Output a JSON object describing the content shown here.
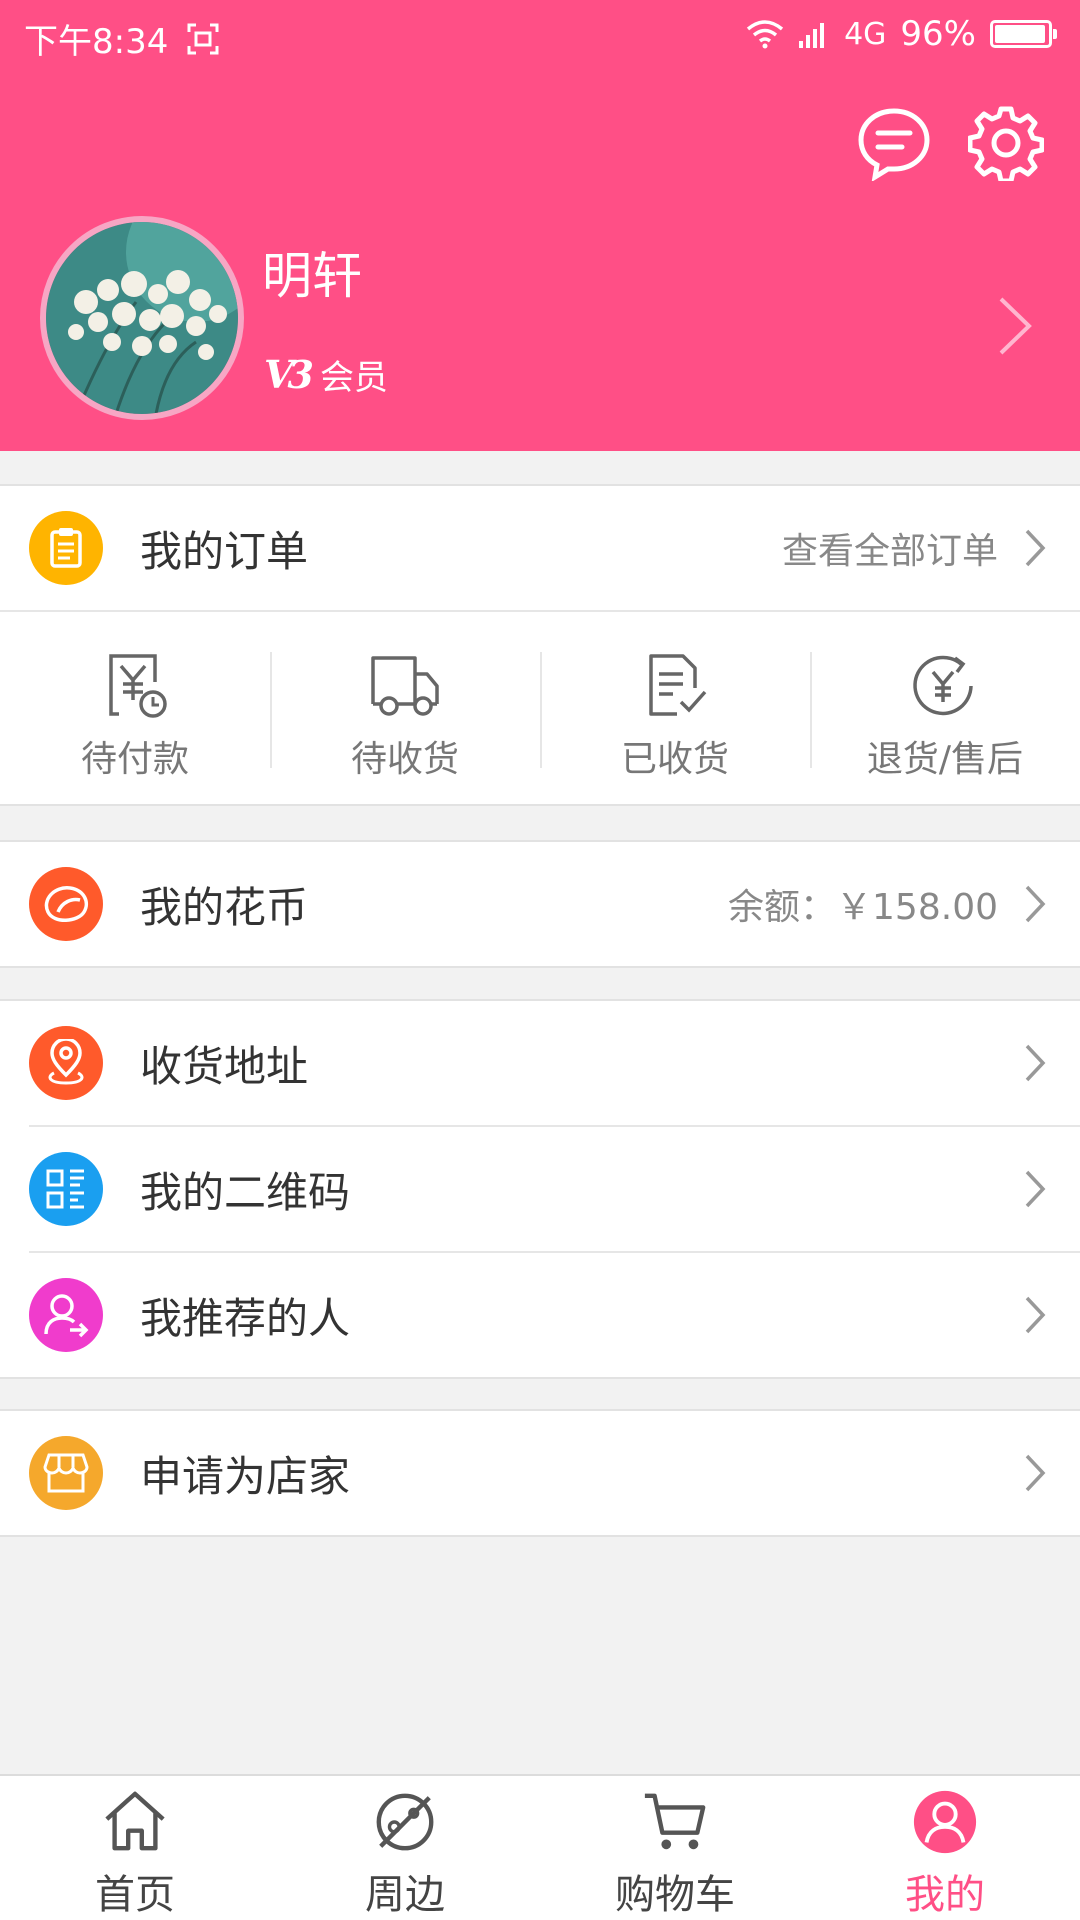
{
  "status_bar": {
    "time": "下午8:34",
    "network": "4G",
    "battery": "96%",
    "battery_level": 0.96
  },
  "profile": {
    "name": "明轩",
    "badge": "V3",
    "member_label": "会员"
  },
  "orders": {
    "title": "我的订单",
    "view_all": "查看全部订单",
    "statuses": [
      {
        "label": "待付款",
        "icon": "payment-pending-icon"
      },
      {
        "label": "待收货",
        "icon": "delivery-truck-icon"
      },
      {
        "label": "已收货",
        "icon": "received-document-icon"
      },
      {
        "label": "退货/售后",
        "icon": "refund-icon"
      }
    ]
  },
  "coins": {
    "title": "我的花币",
    "balance": "余额：￥158.00"
  },
  "menu": [
    {
      "label": "收货地址",
      "icon": "location-icon",
      "color": "#ff5a2b"
    },
    {
      "label": "我的二维码",
      "icon": "qrcode-icon",
      "color": "#1a9ff0"
    },
    {
      "label": "我推荐的人",
      "icon": "referral-user-icon",
      "color": "#f03ccc"
    }
  ],
  "shop": {
    "label": "申请为店家",
    "icon": "store-icon",
    "color": "#f5a82c"
  },
  "tabs": [
    {
      "label": "首页",
      "icon": "home-icon",
      "active": false
    },
    {
      "label": "周边",
      "icon": "nearby-planet-icon",
      "active": false
    },
    {
      "label": "购物车",
      "icon": "cart-icon",
      "active": false
    },
    {
      "label": "我的",
      "icon": "profile-icon",
      "active": true
    }
  ],
  "colors": {
    "brand": "#ff4f86",
    "orders_icon": "#ffb400",
    "coins_icon": "#ff5a2b"
  }
}
